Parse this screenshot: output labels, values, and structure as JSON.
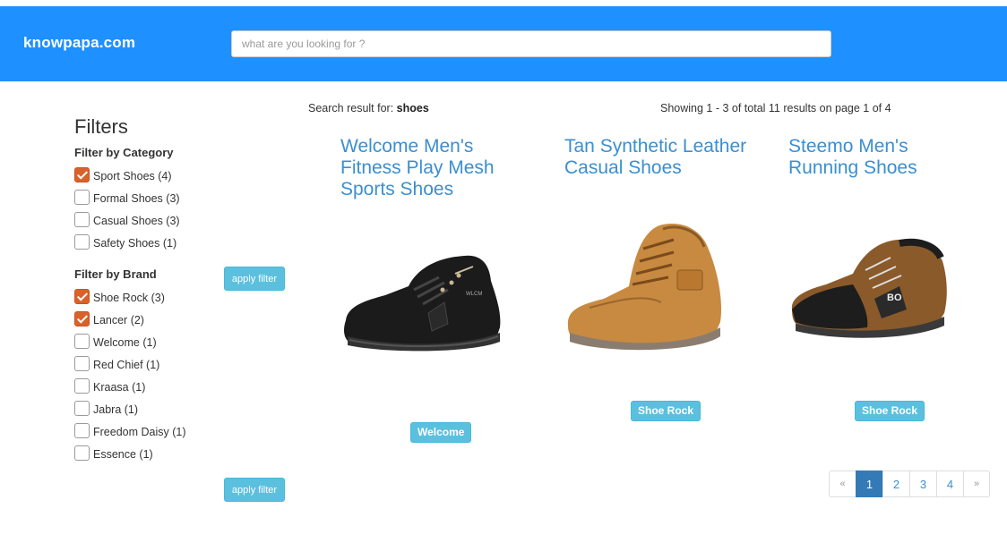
{
  "header": {
    "brand": "knowpapa.com",
    "search_placeholder": "what are you looking for ?"
  },
  "filters": {
    "title": "Filters",
    "category": {
      "title": "Filter by Category",
      "items": [
        {
          "label": "Sport Shoes (4)",
          "checked": true
        },
        {
          "label": "Formal Shoes (3)",
          "checked": false
        },
        {
          "label": "Casual Shoes (3)",
          "checked": false
        },
        {
          "label": "Safety Shoes (1)",
          "checked": false
        }
      ]
    },
    "brand": {
      "title": "Filter by Brand",
      "items": [
        {
          "label": "Shoe Rock (3)",
          "checked": true
        },
        {
          "label": "Lancer (2)",
          "checked": true
        },
        {
          "label": "Welcome (1)",
          "checked": false
        },
        {
          "label": "Red Chief (1)",
          "checked": false
        },
        {
          "label": "Kraasa (1)",
          "checked": false
        },
        {
          "label": "Jabra (1)",
          "checked": false
        },
        {
          "label": "Freedom Daisy (1)",
          "checked": false
        },
        {
          "label": "Essence (1)",
          "checked": false
        }
      ]
    },
    "apply_label": "apply filter"
  },
  "results": {
    "search_prefix": "Search result for: ",
    "query": "shoes",
    "showing": "Showing 1 - 3 of total 11 results on page 1 of 4"
  },
  "products": [
    {
      "title": "Welcome Men's Fitness Play Mesh Sports Shoes",
      "brand": "Welcome",
      "image": "black-sneaker-image"
    },
    {
      "title": "Tan Synthetic Leather Casual Shoes",
      "brand": "Shoe Rock",
      "image": "tan-boot-image"
    },
    {
      "title": "Steemo Men's Running Shoes",
      "brand": "Shoe Rock",
      "image": "brown-black-boot-image"
    }
  ],
  "pagination": {
    "prev": "«",
    "pages": [
      "1",
      "2",
      "3",
      "4"
    ],
    "active": "1",
    "next": "»"
  },
  "colors": {
    "header_bg": "#1e90ff",
    "link": "#3a8fd0",
    "button": "#5bc0de",
    "checked": "#d9622b",
    "pager_active": "#337ab7"
  }
}
